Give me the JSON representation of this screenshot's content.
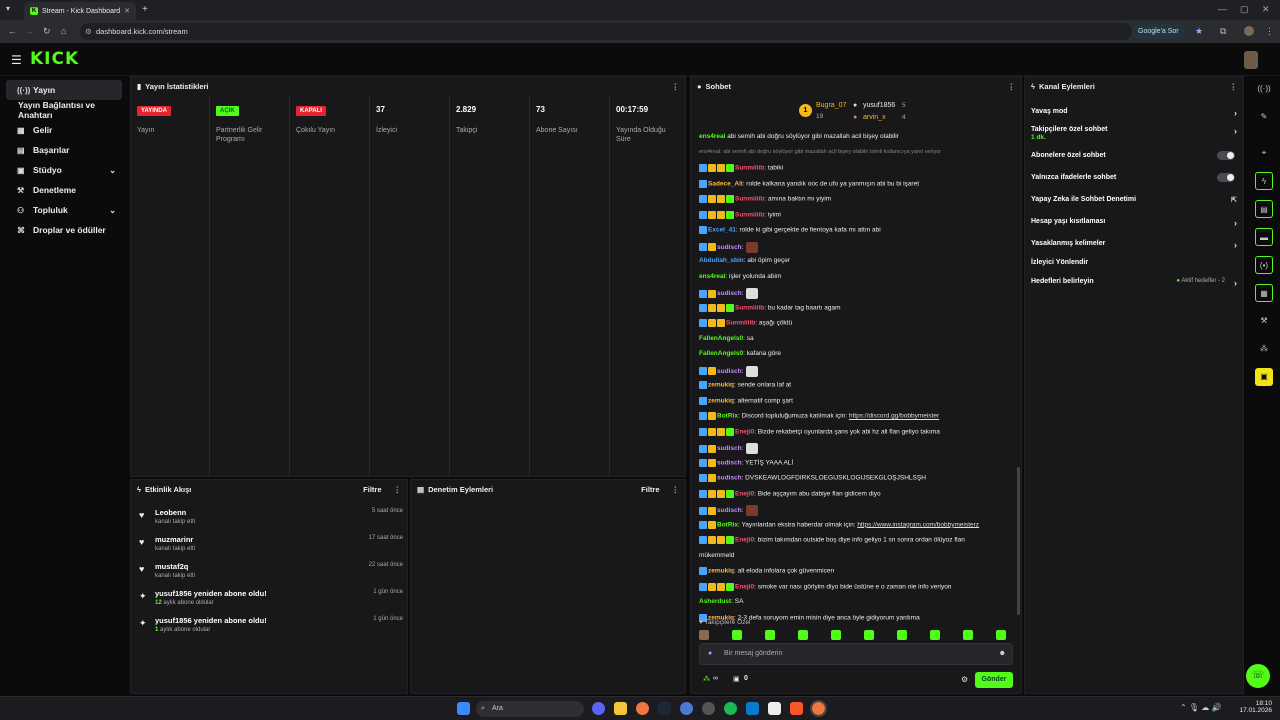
{
  "browser": {
    "tab_title": "Stream - Kick Dashboard",
    "url": "dashboard.kick.com/stream",
    "google_btn": "Google'a Sor"
  },
  "header": {
    "logo": "KICK"
  },
  "sidebar": {
    "items": [
      {
        "label": "Yayın",
        "icon": "broadcast-icon"
      },
      {
        "label": "Yayın Bağlantısı ve Anahtarı",
        "icon": ""
      },
      {
        "label": "Gelir",
        "icon": "revenue-icon"
      },
      {
        "label": "Başarılar",
        "icon": "achievements-icon"
      },
      {
        "label": "Stüdyo",
        "icon": "studio-icon"
      },
      {
        "label": "Denetleme",
        "icon": "moderation-icon"
      },
      {
        "label": "Topluluk",
        "icon": "community-icon"
      },
      {
        "label": "Droplar ve ödüller",
        "icon": "gift-icon"
      }
    ]
  },
  "stats": {
    "title": "Yayın İstatistikleri",
    "items": [
      {
        "value": "YAYINDA",
        "label": "Yayın",
        "kind": "red"
      },
      {
        "value": "AÇIK",
        "label": "Partnerlik Gelir Programı",
        "kind": "green"
      },
      {
        "value": "KAPALI",
        "label": "Çokılu Yayın",
        "kind": "red"
      },
      {
        "value": "37",
        "label": "İzleyici",
        "kind": "num"
      },
      {
        "value": "2.829",
        "label": "Takipçi",
        "kind": "num"
      },
      {
        "value": "73",
        "label": "Abone Sayısı",
        "kind": "num"
      },
      {
        "value": "00:17:59",
        "label": "Yayında Olduğu Süre",
        "kind": "num"
      }
    ]
  },
  "events": {
    "title": "Etkinlik Akışı",
    "filter": "Filtre",
    "items": [
      {
        "name": "Leobenn",
        "sub": "kanalı takip etti",
        "time": "5 saat önce",
        "icon": "heart-icon"
      },
      {
        "name": "muzmarinr",
        "sub": "kanalı takip etti",
        "time": "17 saat önce",
        "icon": "heart-icon"
      },
      {
        "name": "mustaf2q",
        "sub": "kanalı takip etti",
        "time": "22 saat önce",
        "icon": "heart-icon"
      },
      {
        "name": "yusuf1856 yeniden abone oldu!",
        "count": "12",
        "sub": " aylık abone oldular",
        "time": "1 gün önce",
        "icon": "star-icon"
      },
      {
        "name": "yusuf1856 yeniden abone oldu!",
        "count": "1",
        "sub": " aylık abone oldular",
        "time": "1 gün önce",
        "icon": "star-icon"
      }
    ]
  },
  "moderation": {
    "title": "Denetim Eylemleri",
    "filter": "Filtre"
  },
  "chat": {
    "title": "Sohbet",
    "top_gifters": [
      {
        "name": "Bugra_07",
        "count": "19"
      },
      {
        "name": "yusuf1856",
        "count": "5"
      },
      {
        "name": "arvin_x",
        "count": "4"
      }
    ],
    "messages": [
      {
        "user": "ens4real",
        "text": " abi semih abi doğru söylüyor gibi mazallah acil bişey olabilir",
        "color": "#53fc18",
        "badges": 0
      },
      {
        "user": "",
        "text": "ens4real: abi semih abi doğru söylüyor gibi mazallah acil bişey olabilir isimli kullanıcıya yanıt veriyor",
        "color": "#888",
        "badges": 0,
        "reply": true
      },
      {
        "user": "Sunmiiiib",
        "text": ": tabiki",
        "color": "#ff4d6d",
        "badges": 4
      },
      {
        "user": "Sadece_Ali",
        "text": ": rolde kalkana yandık ooc de ufo ya yanmışın abi bu bi işaret",
        "color": "#ffb83b",
        "badges": 1
      },
      {
        "user": "Sunmiiiib",
        "text": ": amına baktın mı yiyim",
        "color": "#ff4d6d",
        "badges": 4
      },
      {
        "user": "Sunmiiiib",
        "text": ": iyimi",
        "color": "#ff4d6d",
        "badges": 4
      },
      {
        "user": "Excel_41",
        "text": ": rolde ki gibi gerçekte de fientoya kafa mı attın abi",
        "color": "#4aa3ff",
        "badges": 1
      },
      {
        "user": "sudisch",
        "text": ":",
        "color": "#c28cff",
        "badges": 2,
        "emote": "#7a3b2c"
      },
      {
        "user": "Abdullah_sbin",
        "text": ": abi öpim geçer",
        "color": "#4aa3ff",
        "badges": 0
      },
      {
        "user": "ens4real",
        "text": ": işler yolunda abim",
        "color": "#53fc18",
        "badges": 0
      },
      {
        "user": "sudisch",
        "text": ":",
        "color": "#c28cff",
        "badges": 2,
        "emote": "#ddd"
      },
      {
        "user": "Sunmiiiib",
        "text": ": bu kadar tag baartı agam",
        "color": "#ff4d6d",
        "badges": 4
      },
      {
        "user": "Sunmiiiib",
        "text": ": aşağı çöktü",
        "color": "#ff4d6d",
        "badges": 3
      },
      {
        "user": "FallenAngels0",
        "text": ": sa",
        "color": "#53fc18",
        "badges": 0
      },
      {
        "user": "FallenAngels0",
        "text": ": kafana göre",
        "color": "#53fc18",
        "badges": 0
      },
      {
        "user": "sudisch",
        "text": ":",
        "color": "#c28cff",
        "badges": 2,
        "emote": "#ddd"
      },
      {
        "user": "zemukiq",
        "text": ": sende onlara laf at",
        "color": "#ffb83b",
        "badges": 1
      },
      {
        "user": "zemukiq",
        "text": ": alternatif comp şart",
        "color": "#ffb83b",
        "badges": 1
      },
      {
        "user": "BotRix",
        "text": ": Discord topluluğumuza katılmak için: ",
        "link": "https://discord.gg/bobbymeister",
        "color": "#53fc18",
        "badges": 2
      },
      {
        "user": "Eneji0",
        "text": ": Bizde rekabetçi oyunlarda şans yok abi hz ali flan geliyo takıma",
        "color": "#ff4d6d",
        "badges": 4
      },
      {
        "user": "sudisch",
        "text": ":",
        "color": "#c28cff",
        "badges": 2,
        "emote": "#ddd"
      },
      {
        "user": "sudisch",
        "text": ": YETİŞ YAAA ALİ",
        "color": "#c28cff",
        "badges": 2
      },
      {
        "user": "sudisch",
        "text": ": DVSKEAWLOGFDIRKSLOEGIJSKLOGIJSEKGLOŞJSHLSŞH",
        "color": "#c28cff",
        "badges": 2
      },
      {
        "user": "Eneji0",
        "text": ": Bide aşçayım abu dabiye flan gidicem diyo",
        "color": "#ff4d6d",
        "badges": 4
      },
      {
        "user": "sudisch",
        "text": ":",
        "color": "#c28cff",
        "badges": 2,
        "emote": "#7a3b2c"
      },
      {
        "user": "BotRix",
        "text": ": Yayınlardan ekstra haberdar olmak için: ",
        "link": "https://www.instagram.com/bobbymeisterz",
        "color": "#53fc18",
        "badges": 2
      },
      {
        "user": "Eneji0",
        "text": ": bizim takımdan outside boş diye info geliyo 1 sn sonra ordan ölüyoz flan",
        "color": "#ff4d6d",
        "badges": 4
      },
      {
        "user": "",
        "text": "mükemmeld",
        "color": "#eee",
        "badges": 0,
        "cont": true
      },
      {
        "user": "zemukiq",
        "text": ": alt eloda infolara çok güvenmicen",
        "color": "#ffb83b",
        "badges": 1
      },
      {
        "user": "Eneji0",
        "text": ": smoke var nası görlyim diyo bide üstüne e o zaman nie info veriyon",
        "color": "#ff4d6d",
        "badges": 4
      },
      {
        "user": "Asherdust",
        "text": ": SA",
        "color": "#53fc18",
        "badges": 0
      },
      {
        "user": "zemukiq",
        "text": ": 2-3 defa soruyom emin misin diye anca öyle gidiyorum yardıma",
        "color": "#ffb83b",
        "badges": 1
      }
    ],
    "followers_only": "Takipçilere Özel",
    "input_placeholder": "Bir mesaj gönderin",
    "points": "∞",
    "cart_count": "0",
    "send": "Gönder"
  },
  "actions": {
    "title": "Kanal Eylemleri",
    "items": [
      {
        "label": "Yavaş mod",
        "kind": "chev"
      },
      {
        "label": "Takipçilere özel sohbet",
        "sub": "1 dk.",
        "kind": "chev"
      },
      {
        "label": "Abonelere özel sohbet",
        "kind": "toggle"
      },
      {
        "label": "Yalnızca ifadelerle sohbet",
        "kind": "toggle"
      },
      {
        "label": "Yapay Zeka ile Sohbet Denetimi",
        "kind": "ext"
      },
      {
        "label": "Hesap yaşı kısıtlaması",
        "kind": "chev"
      },
      {
        "label": "Yasaklanmış kelimeler",
        "kind": "chev"
      },
      {
        "label": "İzleyici Yönlendir",
        "kind": "none"
      },
      {
        "label": "Hedefleri belirleyin",
        "kind": "chev",
        "status": "Aktif hedefler - 2"
      }
    ]
  },
  "taskbar": {
    "search": "Ara",
    "time": "18:10",
    "date": "17.01.2026"
  },
  "colors": {
    "accent": "#53fc18",
    "live": "#e5242f",
    "bg": "#0b0b0c",
    "panel": "#18181b"
  }
}
